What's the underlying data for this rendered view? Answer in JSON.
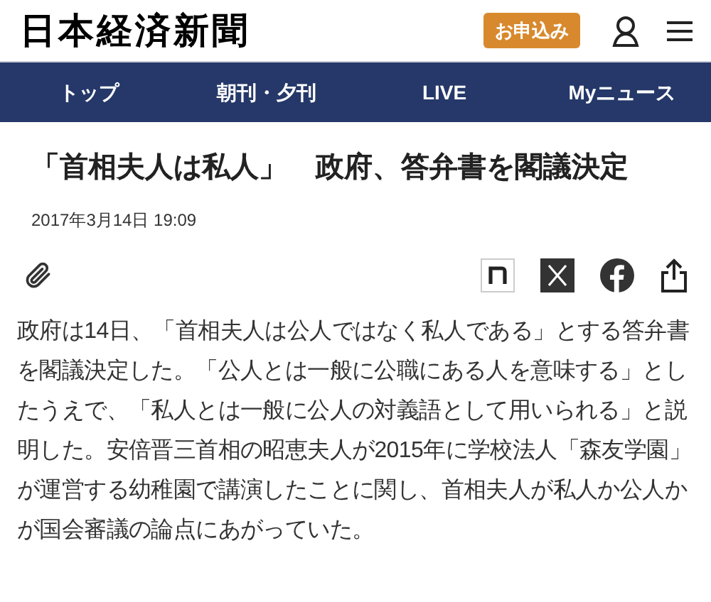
{
  "header": {
    "logo": "日本経済新聞",
    "subscribe_button": "お申込み"
  },
  "nav": [
    {
      "label": "トップ"
    },
    {
      "label": "朝刊・夕刊"
    },
    {
      "label": "LIVE"
    },
    {
      "label": "Myニュース"
    }
  ],
  "article": {
    "title": "「首相夫人は私人」　政府、答弁書を閣議決定",
    "date": "2017年3月14日 19:09",
    "body": "政府は14日、「首相夫人は公人ではなく私人である」とする答弁書を閣議決定した。「公人とは一般に公職にある人を意味する」としたうえで、「私人とは一般に公人の対義語として用いられる」と説明した。安倍晋三首相の昭恵夫人が2015年に学校法人「森友学園」が運営する幼稚園で講演したことに関し、首相夫人が私人か公人かが国会審議の論点にあがっていた。"
  }
}
